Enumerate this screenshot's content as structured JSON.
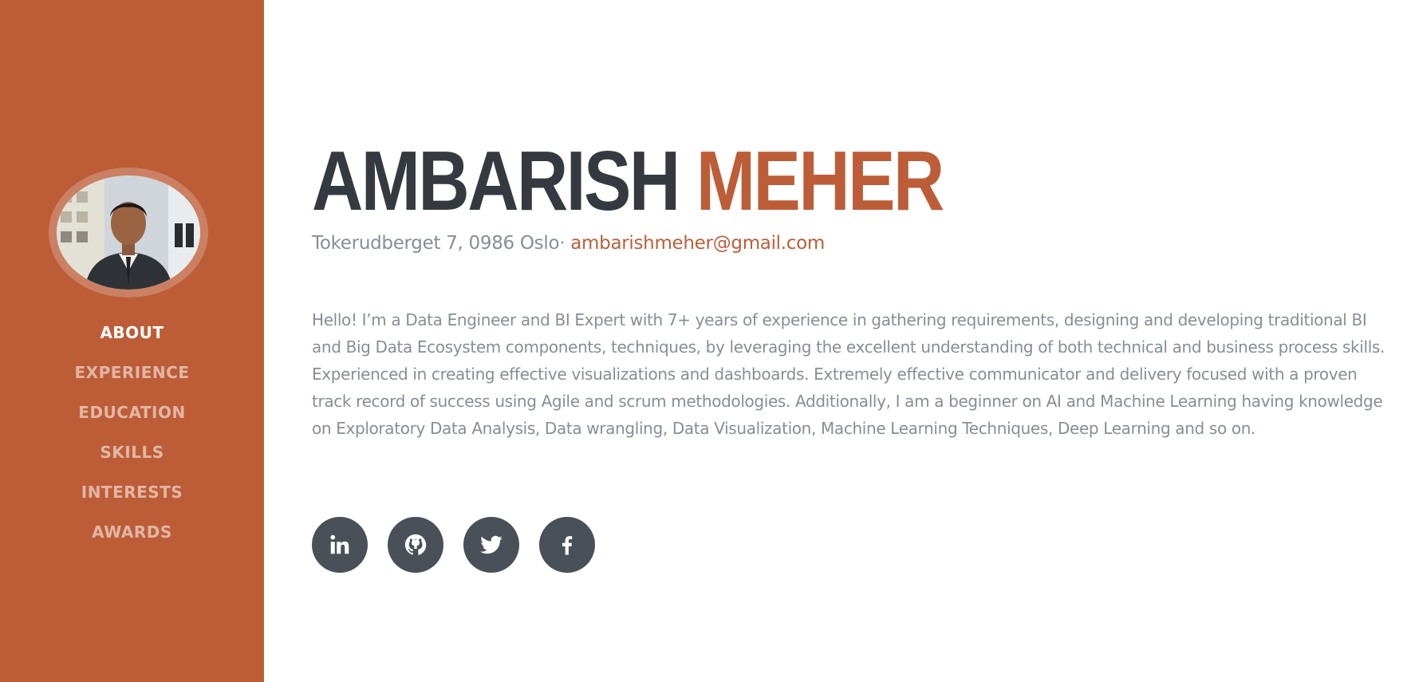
{
  "sidebar": {
    "profile_image": "profile-photo",
    "nav": [
      {
        "label": "ABOUT",
        "active": true
      },
      {
        "label": "EXPERIENCE",
        "active": false
      },
      {
        "label": "EDUCATION",
        "active": false
      },
      {
        "label": "SKILLS",
        "active": false
      },
      {
        "label": "INTERESTS",
        "active": false
      },
      {
        "label": "AWARDS",
        "active": false
      }
    ]
  },
  "about": {
    "first_name": "AMBARISH",
    "last_name": "MEHER",
    "address": "Tokerudberget 7, 0986 Oslo· ",
    "email": "ambarishmeher@gmail.com",
    "bio": "Hello! I’m a Data Engineer and BI Expert with 7+ years of experience in gathering requirements, designing and developing traditional BI and Big Data Ecosystem components, techniques, by leveraging the excellent understanding of both technical and business process skills. Experienced in creating effective visualizations and dashboards. Extremely effective communicator and delivery focused with a proven track record of success using Agile and scrum methodologies. Additionally, I am a beginner on AI and Machine Learning having knowledge on Exploratory Data Analysis, Data wrangling, Data Visualization, Machine Learning Techniques, Deep Learning and so on.",
    "social": [
      {
        "icon": "linkedin-icon"
      },
      {
        "icon": "github-icon"
      },
      {
        "icon": "twitter-icon"
      },
      {
        "icon": "facebook-icon"
      }
    ]
  },
  "colors": {
    "primary": "#bd5d38",
    "heading": "#343a40",
    "muted": "#868e96",
    "social_bg": "#495057"
  }
}
